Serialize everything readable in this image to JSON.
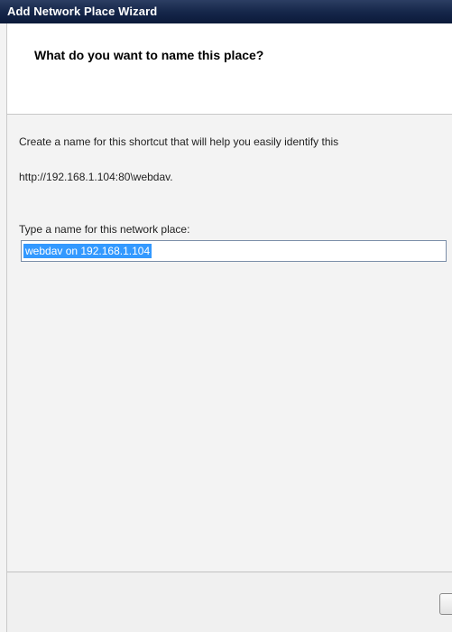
{
  "window": {
    "title": "Add Network Place Wizard"
  },
  "header": {
    "heading": "What do you want to name this place?"
  },
  "main": {
    "description": "Create a name for this shortcut that will help you easily identify this",
    "url": "http://192.168.1.104:80\\webdav.",
    "name_label": "Type a name for this network place:",
    "name_value": "webdav on 192.168.1.104"
  },
  "footer": {
    "button_label": ""
  }
}
